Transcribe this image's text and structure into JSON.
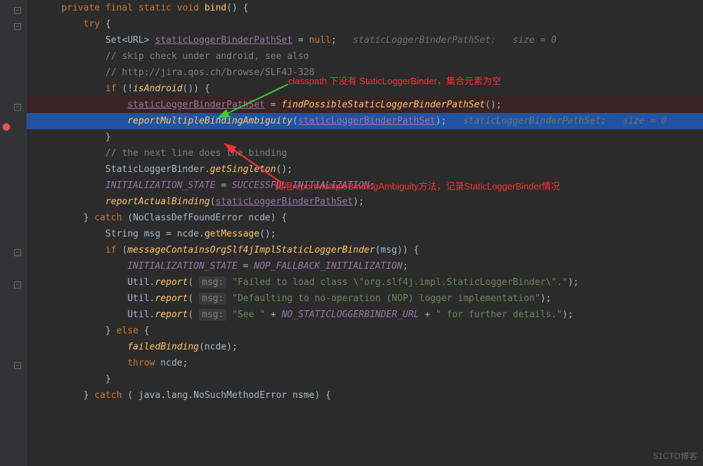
{
  "code": {
    "l1": {
      "kw1": "private final static void ",
      "method": "bind",
      "p": "() {"
    },
    "l2": {
      "kw": "try ",
      "b": "{"
    },
    "l3": {
      "t": "Set<URL> ",
      "f": "staticLoggerBinderPathSet",
      "eq": " = ",
      "kw": "null",
      "sc": ";",
      "hint": "   staticLoggerBinderPathSet:   size = 0"
    },
    "l4": {
      "c": "// skip check under android, see also"
    },
    "l5": {
      "c": "// http://jira.qos.ch/browse/SLF4J-328"
    },
    "l6": {
      "kw": "if ",
      "p": "(!",
      "m": "isAndroid",
      "p2": "()) {"
    },
    "l7": {
      "f": "staticLoggerBinderPathSet",
      "eq": " = ",
      "m": "findPossibleStaticLoggerBinderPathSet",
      "p": "();"
    },
    "l8": {
      "m": "reportMultipleBindingAmbiguity",
      "p1": "(",
      "f": "staticLoggerBinderPathSet",
      "p2": ");",
      "hint": "   staticLoggerBinderPathSet:   size = 0"
    },
    "l9": {
      "b": "}"
    },
    "l10": {
      "c": "// the next line does the binding"
    },
    "l11": {
      "t": "StaticLoggerBinder",
      "d": ".",
      "m": "getSingleton",
      "p": "();"
    },
    "l12": {
      "c1": "INITIALIZATION_STATE",
      "eq": " = ",
      "c2": "SUCCESSFUL_INITIALIZATION",
      "sc": ";"
    },
    "l13": {
      "m": "reportActualBinding",
      "p1": "(",
      "f": "staticLoggerBinderPathSet",
      "p2": ");"
    },
    "l14": {
      "b1": "} ",
      "kw": "catch ",
      "p": "(NoClassDefFoundError ncde) {"
    },
    "l15": {
      "t": "String msg = ncde.",
      "m": "getMessage",
      "p": "();"
    },
    "l16": {
      "kw": "if ",
      "p1": "(",
      "m": "messageContainsOrgSlf4jImplStaticLoggerBinder",
      "p2": "(msg)) {"
    },
    "l17": {
      "c1": "INITIALIZATION_STATE",
      "eq": " = ",
      "c2": "NOP_FALLBACK_INITIALIZATION",
      "sc": ";"
    },
    "l18": {
      "t": "Util.",
      "m": "report",
      "p1": "( ",
      "h": "msg:",
      "sp": " ",
      "s": "\"Failed to load class \\\"org.slf4j.impl.StaticLoggerBinder\\\".\"",
      "p2": ");"
    },
    "l19": {
      "t": "Util.",
      "m": "report",
      "p1": "( ",
      "h": "msg:",
      "sp": " ",
      "s": "\"Defaulting to no-operation (NOP) logger implementation\"",
      "p2": ");"
    },
    "l20": {
      "t": "Util.",
      "m": "report",
      "p1": "( ",
      "h": "msg:",
      "sp": " ",
      "s1": "\"See \"",
      "pl": " + ",
      "c": "NO_STATICLOGGERBINDER_URL",
      "pl2": " + ",
      "s2": "\" for further details.\"",
      "p2": ");"
    },
    "l21": {
      "b1": "} ",
      "kw": "else ",
      "b2": "{"
    },
    "l22": {
      "m": "failedBinding",
      "p": "(ncde);"
    },
    "l23": {
      "kw": "throw ",
      "v": "ncde;"
    },
    "l24": {
      "b": "}"
    },
    "l25": {
      "b1": "} ",
      "kw": "catch ",
      "p": "( java.lang.NoSuchMethodError nsme) {"
    }
  },
  "annotations": {
    "a1": "classpath 下没有 StaticLoggerBinder，集合元素为空",
    "a2": "调用reportMultipleBindingAmbiguity方法，记录StaticLoggerBinder情况"
  },
  "watermark": "51CTO博客"
}
